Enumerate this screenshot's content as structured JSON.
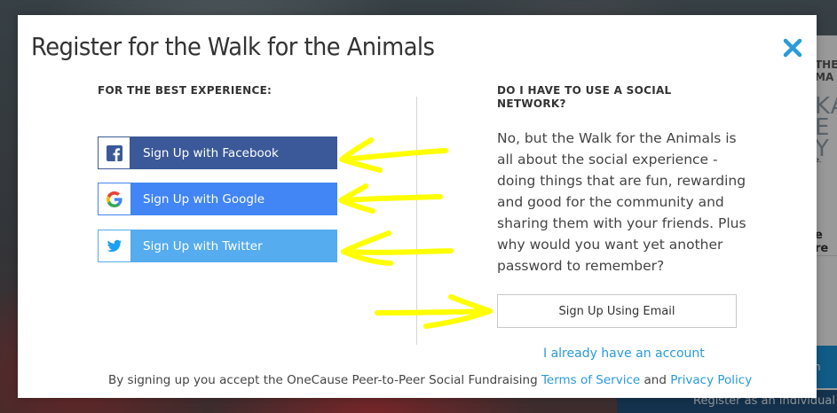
{
  "modal": {
    "title": "Register for the Walk for the Animals",
    "left_heading": "FOR THE BEST EXPERIENCE:",
    "right_heading": "DO I HAVE TO USE A SOCIAL NETWORK?",
    "answer_text": "No, but the Walk for the Animals is all about the social experience - doing things that are fun, rewarding and good for the community and sharing them with your friends. Plus why would you want yet another password to remember?",
    "buttons": {
      "facebook": "Sign Up with Facebook",
      "google": "Sign Up with Google",
      "twitter": "Sign Up with Twitter",
      "email": "Sign Up Using Email"
    },
    "account_link": "I already have an account",
    "footer": {
      "prefix": "By signing up you accept the OneCause Peer-to-Peer Social Fundraising",
      "terms": "Terms of Service",
      "conjunction": "and",
      "privacy": "Privacy Policy"
    }
  },
  "background": {
    "fragment_1": "THE",
    "fragment_2": "MA",
    "fragment_3": "KA",
    "fragment_4": "E",
    "fragment_5": "Y",
    "fragment_6": "e.",
    "fragment_7": "e re",
    "fragment_8": "n",
    "fragment_9": "Register as an individual"
  },
  "colors": {
    "facebook": "#3b5998",
    "google": "#4285f4",
    "twitter": "#55acee",
    "link": "#2a9ad9",
    "close_icon": "#2a9ad9",
    "annotation_arrows": "#ffff00"
  },
  "icons": [
    "facebook-icon",
    "google-icon",
    "twitter-icon",
    "close-icon"
  ]
}
